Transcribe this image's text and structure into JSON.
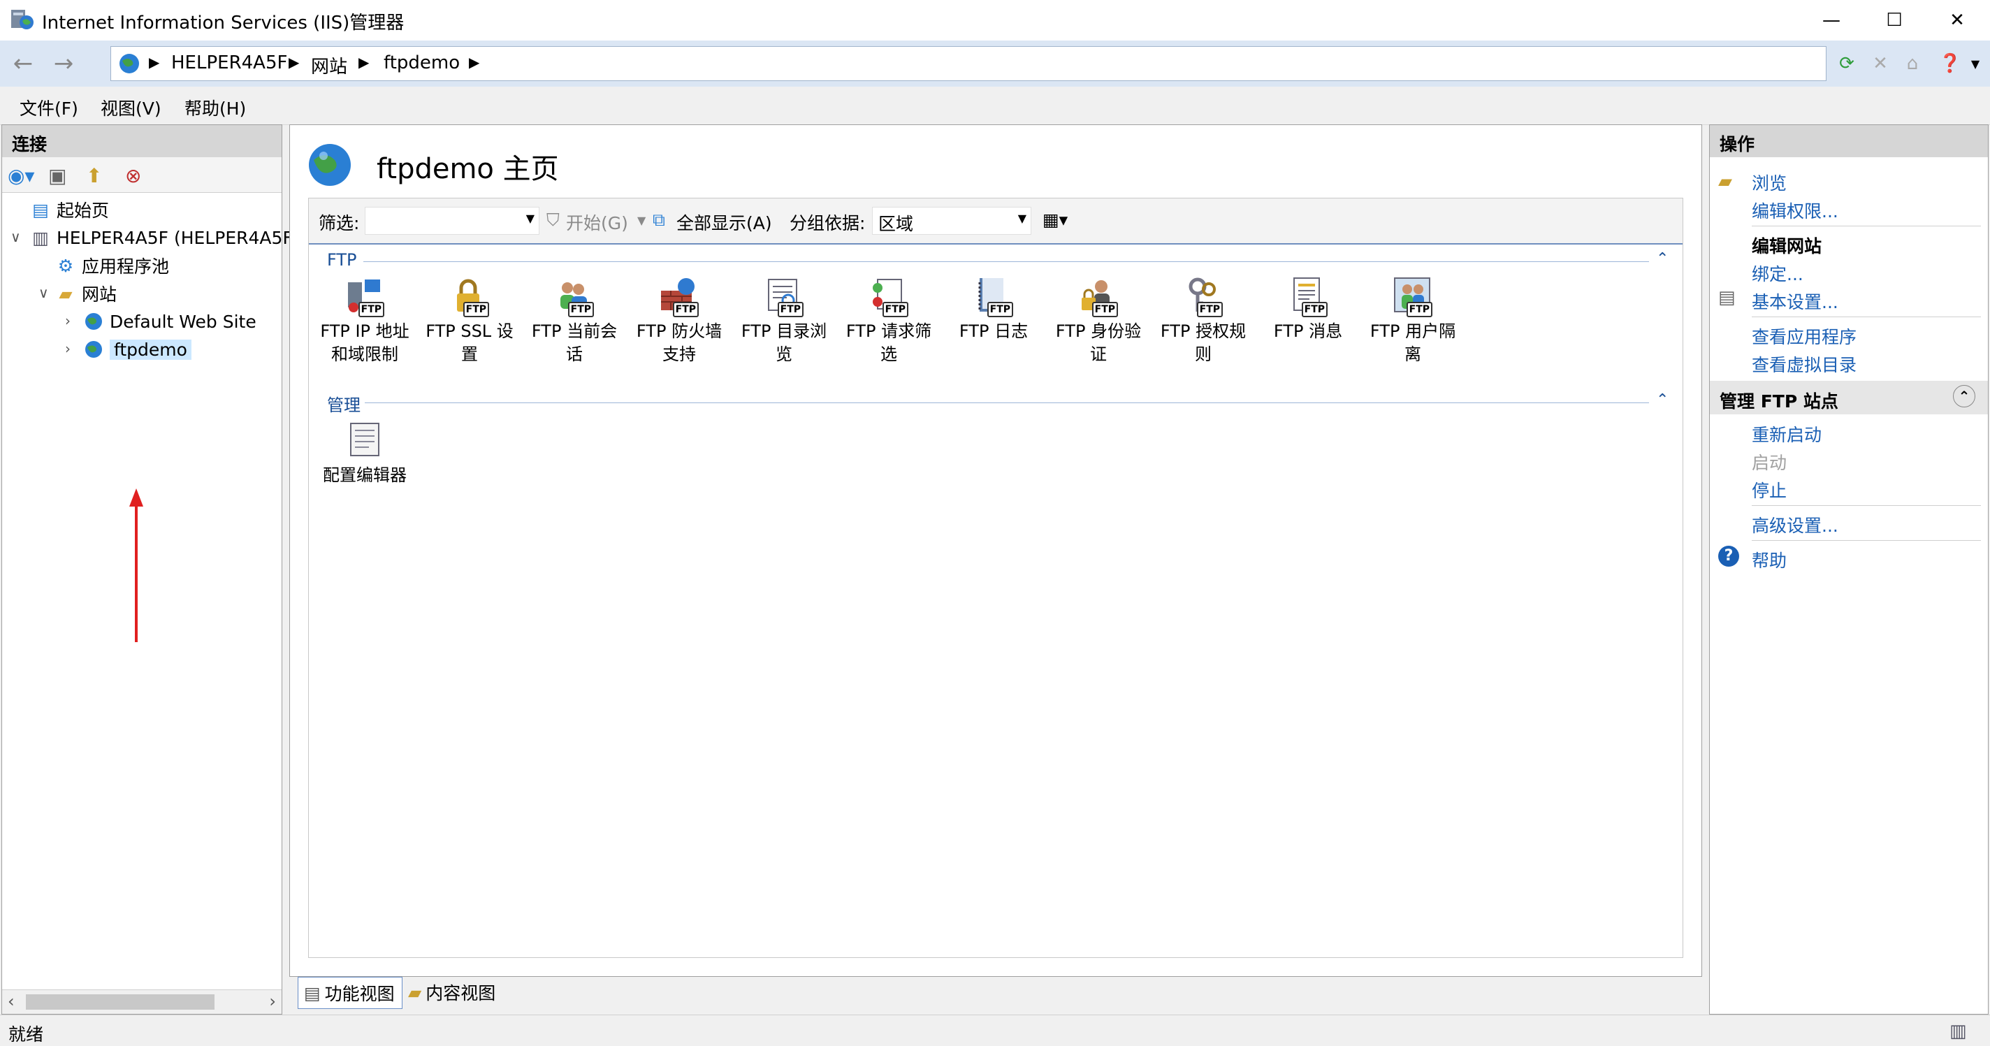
{
  "window": {
    "title": "Internet Information Services (IIS)管理器"
  },
  "address": {
    "crumbs": [
      "HELPER4A5F",
      "网站",
      "ftpdemo"
    ]
  },
  "menu": {
    "file": "文件(F)",
    "view": "视图(V)",
    "help": "帮助(H)"
  },
  "connections": {
    "header": "连接",
    "tree": {
      "start": "起始页",
      "server": "HELPER4A5F (HELPER4A5F\\",
      "app_pools": "应用程序池",
      "sites": "网站",
      "default_site": "Default Web Site",
      "ftpdemo": "ftpdemo"
    }
  },
  "main": {
    "title": "ftpdemo 主页",
    "filter": {
      "label": "筛选:",
      "start": "开始(G)",
      "show_all": "全部显示(A)",
      "group_by_label": "分组依据:",
      "group_by_value": "区域"
    },
    "groups": [
      {
        "name": "FTP",
        "features": [
          {
            "l1": "FTP IP 地址",
            "l2": "和域限制"
          },
          {
            "l1": "FTP SSL 设",
            "l2": "置"
          },
          {
            "l1": "FTP 当前会",
            "l2": "话"
          },
          {
            "l1": "FTP 防火墙",
            "l2": "支持"
          },
          {
            "l1": "FTP 目录浏",
            "l2": "览"
          },
          {
            "l1": "FTP 请求筛",
            "l2": "选"
          },
          {
            "l1": "FTP 日志",
            "l2": ""
          },
          {
            "l1": "FTP 身份验",
            "l2": "证"
          },
          {
            "l1": "FTP 授权规",
            "l2": "则"
          },
          {
            "l1": "FTP 消息",
            "l2": ""
          },
          {
            "l1": "FTP 用户隔",
            "l2": "离"
          }
        ]
      },
      {
        "name": "管理",
        "features": [
          {
            "l1": "配置编辑器",
            "l2": ""
          }
        ]
      }
    ],
    "badge": "FTP",
    "tabs": {
      "features": "功能视图",
      "content": "内容视图"
    }
  },
  "actions": {
    "header": "操作",
    "browse": "浏览",
    "edit_permissions": "编辑权限...",
    "edit_site": "编辑网站",
    "bindings": "绑定...",
    "basic_settings": "基本设置...",
    "view_apps": "查看应用程序",
    "view_vdirs": "查看虚拟目录",
    "manage_ftp": "管理 FTP 站点",
    "restart": "重新启动",
    "start": "启动",
    "stop": "停止",
    "advanced": "高级设置...",
    "help": "帮助"
  },
  "status": {
    "text": "就绪"
  }
}
